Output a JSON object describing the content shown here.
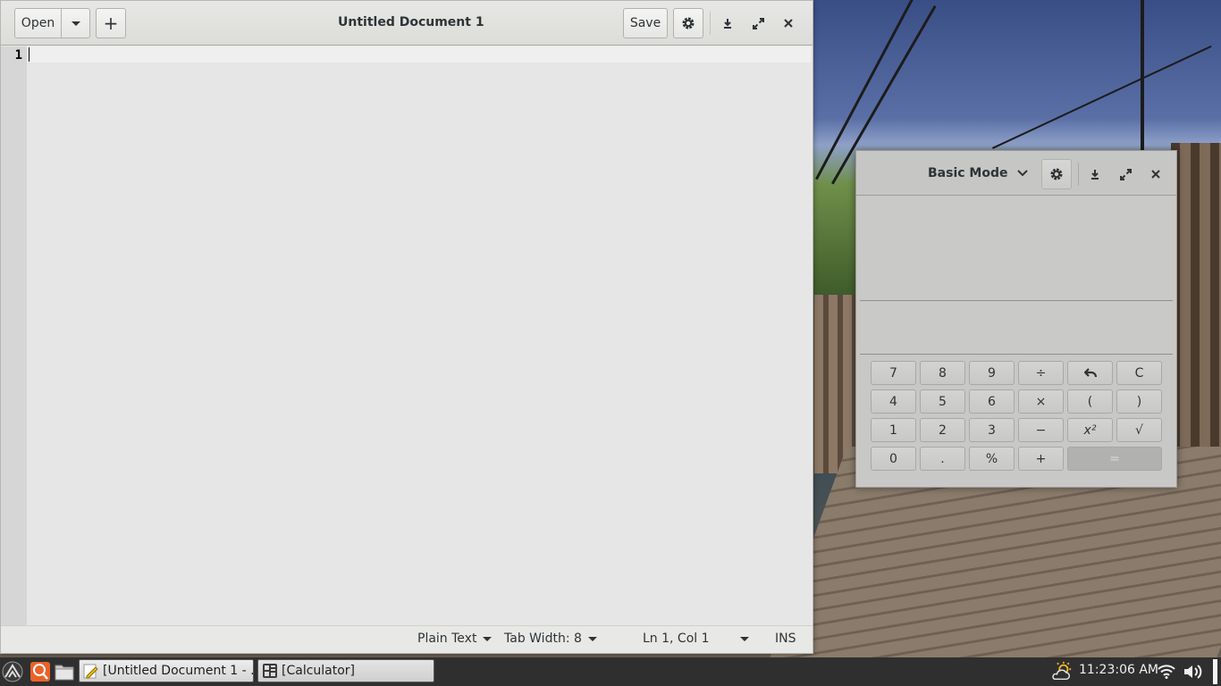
{
  "editor": {
    "title": "Untitled Document 1",
    "open_label": "Open",
    "new_tab_label": "+",
    "save_label": "Save",
    "line_numbers": [
      "1"
    ],
    "status": {
      "language": "Plain Text",
      "tab_width": "Tab Width: 8",
      "position": "Ln 1, Col 1",
      "mode": "INS"
    }
  },
  "calculator": {
    "mode_label": "Basic Mode",
    "keys": [
      [
        "7",
        "8",
        "9",
        "÷",
        "↶",
        "C"
      ],
      [
        "4",
        "5",
        "6",
        "×",
        "(",
        ")"
      ],
      [
        "1",
        "2",
        "3",
        "−",
        "x²",
        "√"
      ],
      [
        "0",
        ".",
        "%",
        "+",
        "="
      ]
    ]
  },
  "taskbar": {
    "tasks": [
      {
        "label": "[Untitled Document 1 - ...",
        "icon": "text-editor-icon"
      },
      {
        "label": "[Calculator]",
        "icon": "calculator-icon"
      }
    ],
    "clock": "11:23:06 AM",
    "icons": [
      "start-menu-icon",
      "search-app-icon",
      "file-manager-icon",
      "weather-icon",
      "wifi-icon",
      "volume-icon"
    ]
  }
}
